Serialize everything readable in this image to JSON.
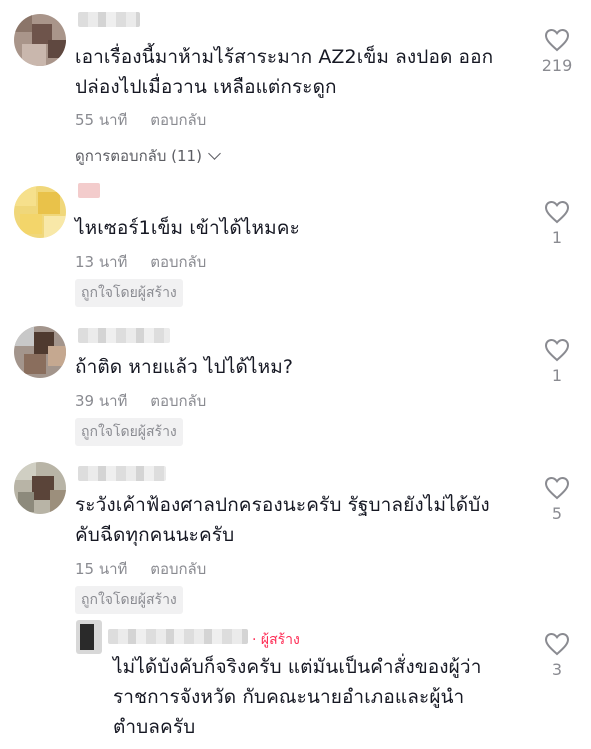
{
  "comments": [
    {
      "text": "เอาเรื่องนี้มาห้ามไร้สาระมาก AZ2เข็ม ลงปอด ออก\nปล่องไปเมื่อวาน เหลือแต่กระดูก",
      "time": "55 นาที",
      "reply": "ตอบกลับ",
      "view_replies": "ดูการตอบกลับ (11)",
      "likes": "219"
    },
    {
      "text": "ไหเซอร์1เข็ม เข้าได้ไหมคะ",
      "time": "13 นาที",
      "reply": "ตอบกลับ",
      "badge": "ถูกใจโดยผู้สร้าง",
      "likes": "1"
    },
    {
      "text": "ถ้าติด หายแล้ว ไปได้ไหม?",
      "time": "39 นาที",
      "reply": "ตอบกลับ",
      "badge": "ถูกใจโดยผู้สร้าง",
      "likes": "1"
    },
    {
      "text": "ระวังเค้าฟ้องศาลปกครองนะครับ รัฐบาลยังไม่ได้บัง\nคับฉีดทุกคนนะครับ",
      "time": "15 นาที",
      "reply": "ตอบกลับ",
      "badge": "ถูกใจโดยผู้สร้าง",
      "likes": "5"
    }
  ],
  "creator_reply": {
    "tag": "· ผู้สร้าง",
    "text": "ไม่ได้บังคับก็จริงครับ แต่มันเป็นคำสั่งของผู้ว่า\nราชการจังหวัด กับคณะนายอำเภอและผู้นำ\nตำบลครับ",
    "likes": "3"
  },
  "icons": {
    "like": "heart-outline-icon",
    "expand": "chevron-down-icon"
  },
  "colors": {
    "text": "#161823",
    "meta": "#8a8b91",
    "creator": "#fe2c55"
  }
}
